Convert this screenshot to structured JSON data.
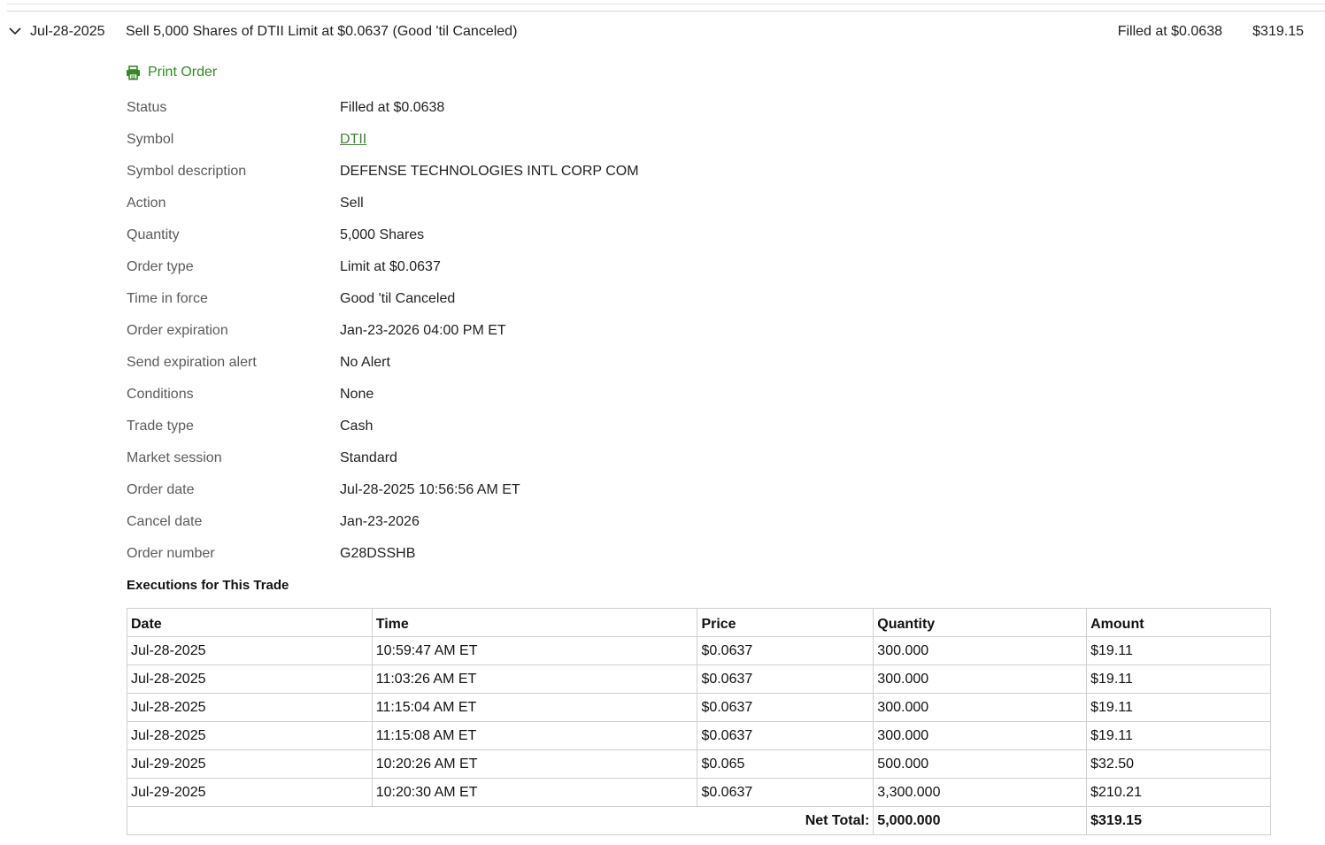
{
  "order": {
    "date": "Jul-28-2025",
    "description": "Sell 5,000 Shares of DTII Limit at $0.0637 (Good 'til Canceled)",
    "status": "Filled at $0.0638",
    "amount": "$319.15",
    "print_label": "Print Order"
  },
  "details": [
    {
      "label": "Status",
      "value": "Filled at $0.0638"
    },
    {
      "label": "Symbol",
      "value": "DTII"
    },
    {
      "label": "Symbol description",
      "value": "DEFENSE TECHNOLOGIES INTL CORP COM"
    },
    {
      "label": "Action",
      "value": "Sell"
    },
    {
      "label": "Quantity",
      "value": "5,000 Shares"
    },
    {
      "label": "Order type",
      "value": "Limit at $0.0637"
    },
    {
      "label": "Time in force",
      "value": "Good 'til Canceled"
    },
    {
      "label": "Order expiration",
      "value": "Jan-23-2026 04:00 PM ET"
    },
    {
      "label": "Send expiration alert",
      "value": "No Alert"
    },
    {
      "label": "Conditions",
      "value": "None"
    },
    {
      "label": "Trade type",
      "value": "Cash"
    },
    {
      "label": "Market session",
      "value": "Standard"
    },
    {
      "label": "Order date",
      "value": "Jul-28-2025 10:56:56 AM ET"
    },
    {
      "label": "Cancel date",
      "value": "Jan-23-2026"
    },
    {
      "label": "Order number",
      "value": "G28DSSHB"
    }
  ],
  "executions": {
    "heading": "Executions for This Trade",
    "headers": [
      "Date",
      "Time",
      "Price",
      "Quantity",
      "Amount"
    ],
    "rows": [
      [
        "Jul-28-2025",
        "10:59:47 AM ET",
        "$0.0637",
        "300.000",
        "$19.11"
      ],
      [
        "Jul-28-2025",
        "11:03:26 AM ET",
        "$0.0637",
        "300.000",
        "$19.11"
      ],
      [
        "Jul-28-2025",
        "11:15:04 AM ET",
        "$0.0637",
        "300.000",
        "$19.11"
      ],
      [
        "Jul-28-2025",
        "11:15:08 AM ET",
        "$0.0637",
        "300.000",
        "$19.11"
      ],
      [
        "Jul-29-2025",
        "10:20:26 AM ET",
        "$0.065",
        "500.000",
        "$32.50"
      ],
      [
        "Jul-29-2025",
        "10:20:30 AM ET",
        "$0.0637",
        "3,300.000",
        "$210.21"
      ]
    ],
    "net_total_label": "Net Total:",
    "net_total_quantity": "5,000.000",
    "net_total_amount": "$319.15"
  },
  "colors": {
    "link_green": "#368727",
    "label_gray": "#5b5b5b",
    "border": "#cfcfcf"
  },
  "icons": {
    "expand": "chevron-down-icon",
    "print": "printer-icon"
  }
}
